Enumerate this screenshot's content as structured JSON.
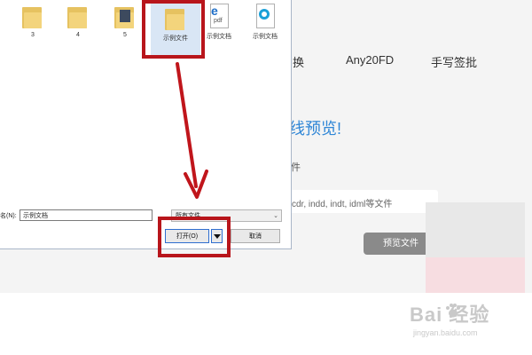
{
  "app": {
    "nav": {
      "convert_partial": "换",
      "any2": "Any20FD",
      "handwrite_sign": "手写签批"
    },
    "headline_partial": "线预览!",
    "subtext_partial": "件",
    "supported_formats_partial": "cdr, indd, indt, idml等文件",
    "preview_button": "预览文件"
  },
  "dialog": {
    "files": [
      {
        "name": "3",
        "icon": "folder-icon"
      },
      {
        "name": "4",
        "icon": "folder-icon"
      },
      {
        "name": "5",
        "icon": "folder-dark-icon"
      },
      {
        "name": "示例文件",
        "icon": "folder-icon",
        "selected": true
      },
      {
        "name": "示例文档",
        "icon": "pdf-file-icon",
        "badge": "pdf"
      },
      {
        "name": "示例文档",
        "icon": "office-file-icon"
      }
    ],
    "filename_label": "名(N):",
    "filename_value": "示例文档",
    "filetype_value": "所有文件",
    "open_button": "打开(O)",
    "cancel_button": "取消"
  },
  "watermark": {
    "brand": "Bai  经验",
    "url": "jingyan.baidu.com"
  },
  "colors": {
    "highlight_red": "#b8151b",
    "arrow_red": "#c0151b",
    "headline_blue": "#2f86d6",
    "preview_button_gray": "#8a8a8a"
  }
}
